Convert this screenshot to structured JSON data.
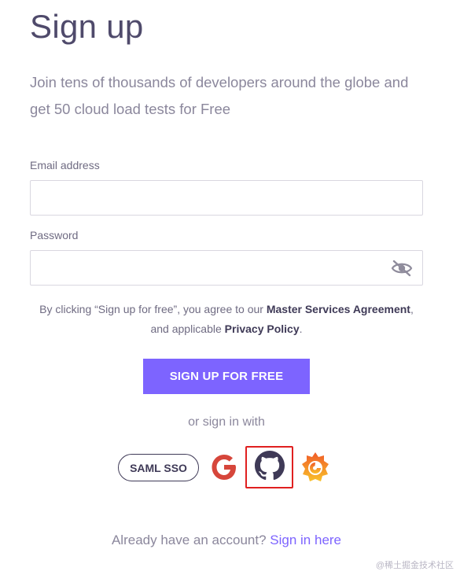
{
  "page": {
    "title": "Sign up",
    "subtitle": "Join tens of thousands of developers around the globe and get 50 cloud load tests for Free"
  },
  "form": {
    "email_label": "Email address",
    "email_value": "",
    "email_placeholder": "",
    "password_label": "Password",
    "password_value": "",
    "password_placeholder": "",
    "password_toggle_icon": "eye-slash-icon"
  },
  "terms": {
    "prefix": "By clicking “Sign up for free”, you agree to our ",
    "msa_link": "Master Services Agreement",
    "middle": ", and applicable ",
    "privacy_link": "Privacy Policy",
    "suffix": "."
  },
  "cta": {
    "label": "SIGN UP FOR FREE",
    "color": "#7d64ff"
  },
  "social": {
    "or_text": "or sign in with",
    "saml_label": "SAML SSO",
    "providers": [
      {
        "name": "google",
        "icon": "google-icon"
      },
      {
        "name": "github",
        "icon": "github-icon",
        "highlighted": true
      },
      {
        "name": "grafana",
        "icon": "grafana-icon"
      }
    ],
    "highlight_color": "#e02020"
  },
  "footer": {
    "prompt": "Already have an account? ",
    "signin_link": "Sign in here"
  },
  "watermark": "@稀土掘金技术社区"
}
